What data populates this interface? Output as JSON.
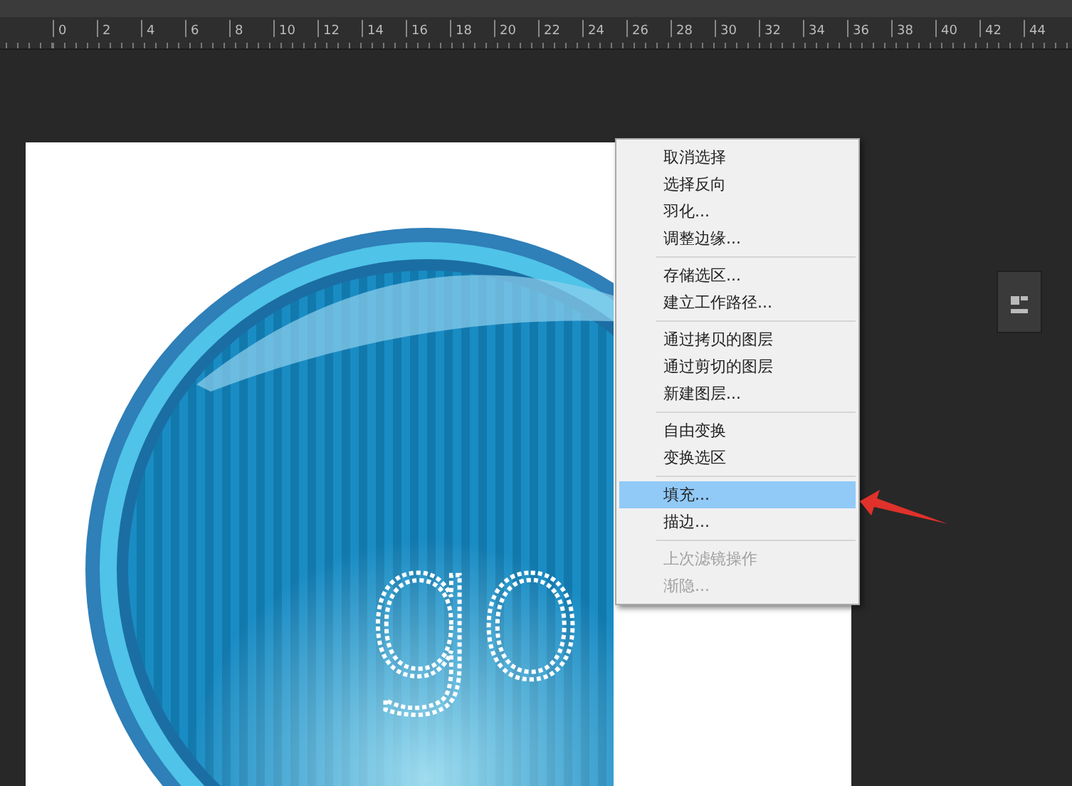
{
  "ruler": {
    "labels": [
      "0",
      "2",
      "4",
      "6",
      "8",
      "10",
      "12",
      "14",
      "16",
      "18",
      "20",
      "22",
      "24",
      "26",
      "28",
      "30",
      "32",
      "34",
      "36",
      "38",
      "40",
      "42",
      "44"
    ]
  },
  "canvas": {
    "text": "go"
  },
  "context_menu": {
    "groups": [
      {
        "items": [
          {
            "label": "取消选择",
            "selected": false,
            "disabled": false
          },
          {
            "label": "选择反向",
            "selected": false,
            "disabled": false
          },
          {
            "label": "羽化...",
            "selected": false,
            "disabled": false
          },
          {
            "label": "调整边缘...",
            "selected": false,
            "disabled": false
          }
        ]
      },
      {
        "items": [
          {
            "label": "存储选区...",
            "selected": false,
            "disabled": false
          },
          {
            "label": "建立工作路径...",
            "selected": false,
            "disabled": false
          }
        ]
      },
      {
        "items": [
          {
            "label": "通过拷贝的图层",
            "selected": false,
            "disabled": false
          },
          {
            "label": "通过剪切的图层",
            "selected": false,
            "disabled": false
          },
          {
            "label": "新建图层...",
            "selected": false,
            "disabled": false
          }
        ]
      },
      {
        "items": [
          {
            "label": "自由变换",
            "selected": false,
            "disabled": false
          },
          {
            "label": "变换选区",
            "selected": false,
            "disabled": false
          }
        ]
      },
      {
        "items": [
          {
            "label": "填充...",
            "selected": true,
            "disabled": false
          },
          {
            "label": "描边...",
            "selected": false,
            "disabled": false
          }
        ]
      },
      {
        "items": [
          {
            "label": "上次滤镜操作",
            "selected": false,
            "disabled": true
          },
          {
            "label": "渐隐...",
            "selected": false,
            "disabled": true
          }
        ]
      }
    ]
  }
}
